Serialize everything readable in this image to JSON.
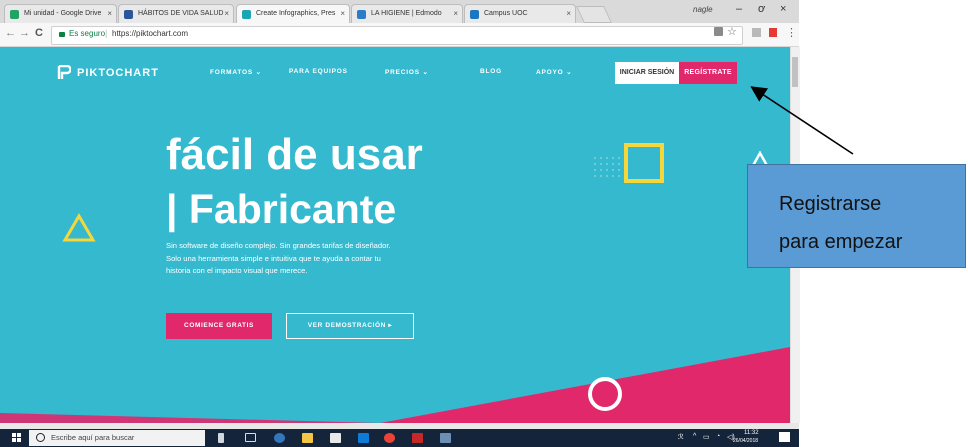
{
  "browser": {
    "tabs": [
      {
        "label": "Mi unidad - Google Drive",
        "color": "#1fa463"
      },
      {
        "label": "HÁBITOS DE VIDA SALUD",
        "color": "#2b579a"
      },
      {
        "label": "Create Infographics, Pres",
        "color": "#1aa5b5"
      },
      {
        "label": "LA HIGIENE | Edmodo",
        "color": "#2c7cc9"
      },
      {
        "label": "Campus UOC",
        "color": "#1a78c2"
      }
    ],
    "profile_name": "nagle",
    "window_controls": {
      "minimize": "–",
      "maximize": "ơ",
      "close": "×"
    },
    "nav": {
      "back": "←",
      "forward": "→",
      "reload": "C"
    },
    "secure_label": "Es seguro",
    "url": "https://piktochart.com",
    "bar_icon_names": [
      "translate-icon",
      "star-icon",
      "extension-icon",
      "pdf-icon",
      "menu-icon"
    ],
    "star_glyph": "☆",
    "menu_glyph": "⋮"
  },
  "site": {
    "logo_text": "PIKTOCHART",
    "menu": [
      "FORMATOS ⌄",
      "PARA EQUIPOS",
      "PRECIOS ⌄",
      "BLOG",
      "APOYO ⌄"
    ],
    "login_label": "INICIAR SESIÓN",
    "register_label": "REGÍSTRATE",
    "headline_line1": "fácil de usar",
    "headline_line2": "| Fabricante",
    "description": [
      "Sin software de diseño complejo. Sin grandes tarifas de diseñador.",
      "Solo una herramienta simple e intuitiva que te ayuda a contar tu",
      "historia con el impacto visual que merece."
    ],
    "cta_start": "COMIENCE GRATIS",
    "cta_demo": "VER DEMOSTRACIÓN  ▸",
    "colors": {
      "background": "#34b9cf",
      "accent": "#e0286a",
      "yellow": "#f5d63d"
    }
  },
  "taskbar": {
    "search_placeholder": "Escribe aquí para buscar",
    "tray": {
      "time": "11:32",
      "date": "26/04/2018"
    }
  },
  "annotation": {
    "callout_line1": "Registrarse",
    "callout_line2": "para empezar"
  }
}
